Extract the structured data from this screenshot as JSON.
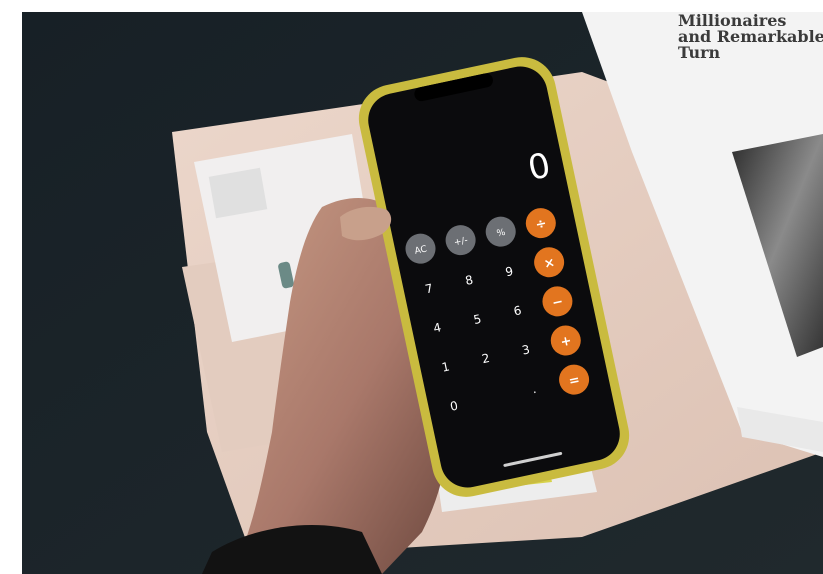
{
  "photo": {
    "subject": "hand holding smartphone showing a calculator app over a desk with folders and papers",
    "colors": {
      "desk": "#1c2428",
      "folder": "#e6cfc2",
      "paper": "#eeeeee",
      "phone_case": "#cfc24a",
      "screen": "#0b0b0d",
      "operator": "#e2751f",
      "function_key": "#6c6f74",
      "skin": "#b88a74"
    }
  },
  "calculator": {
    "display": "0",
    "function_keys": [
      "AC",
      "+/-",
      "%"
    ],
    "operators": [
      "÷",
      "×",
      "−",
      "+",
      "="
    ],
    "rows": [
      [
        "7",
        "8",
        "9"
      ],
      [
        "4",
        "5",
        "6"
      ],
      [
        "1",
        "2",
        "3"
      ],
      [
        "0",
        "",
        "."
      ]
    ]
  },
  "document": {
    "heading_lines": [
      "Millionaires",
      "and Remarkable",
      "Turn"
    ]
  }
}
